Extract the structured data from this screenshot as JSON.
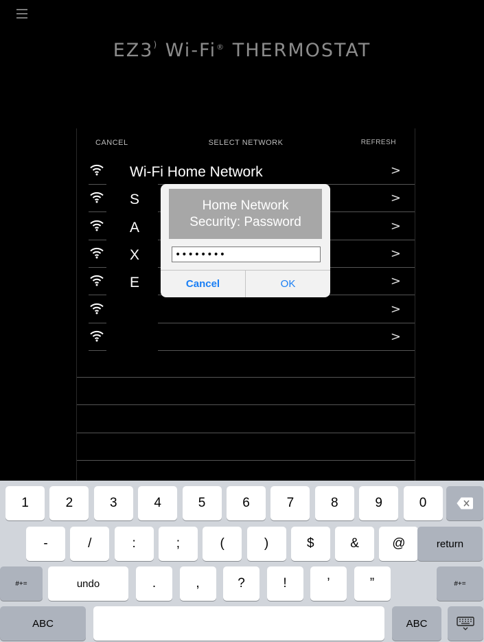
{
  "app": {
    "brand_prefix": "EZ3",
    "brand_suffix": " Wi-Fi",
    "brand_reg": "®",
    "brand_tail": " THERMOSTAT"
  },
  "panel": {
    "cancel_label": "CANCEL",
    "title": "SELECT NETWORK",
    "refresh_label": "REFRESH",
    "networks": [
      {
        "name": "Wi-Fi Home Network",
        "chevron": ">"
      },
      {
        "name": "S",
        "chevron": ">"
      },
      {
        "name": "A",
        "chevron": ">"
      },
      {
        "name": "X",
        "chevron": ">"
      },
      {
        "name": "E",
        "chevron": ">"
      },
      {
        "name": "",
        "chevron": ">"
      },
      {
        "name": "",
        "chevron": ">"
      }
    ]
  },
  "dialog": {
    "title_line1": "Home Network",
    "title_line2": "Security: Password",
    "password_value": "••••••••",
    "cancel_label": "Cancel",
    "ok_label": "OK"
  },
  "keyboard": {
    "row1": [
      "1",
      "2",
      "3",
      "4",
      "5",
      "6",
      "7",
      "8",
      "9",
      "0"
    ],
    "row2": [
      "-",
      "/",
      ":",
      ";",
      "(",
      ")",
      "$",
      "&",
      "@"
    ],
    "return_label": "return",
    "row3": [
      ".",
      ",",
      "?",
      "!",
      "’",
      "”"
    ],
    "symbols_label": "#+=",
    "undo_label": "undo",
    "abc_label": "ABC"
  },
  "colors": {
    "background": "#000000",
    "dialog_button": "#1a7ff5",
    "keyboard_bg": "#d1d5db"
  }
}
